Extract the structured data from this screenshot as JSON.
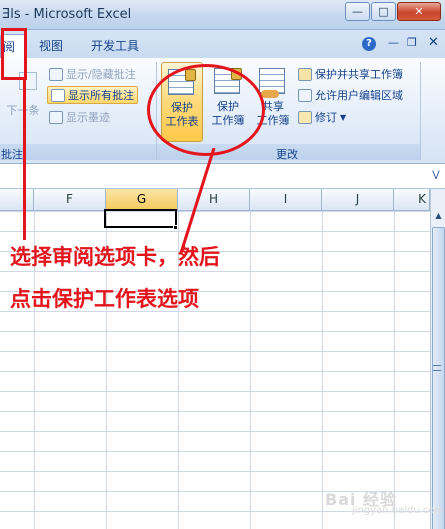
{
  "window": {
    "title": "Ǝls - Microsoft Excel"
  },
  "tabs": [
    {
      "label": "阅"
    },
    {
      "label": "视图"
    },
    {
      "label": "开发工具"
    }
  ],
  "comments_group": {
    "label": "批注",
    "next_label": "下一条",
    "show_hide_label": "显示/隐藏批注",
    "show_all_label": "显示所有批注",
    "show_ink_label": "显示墨迹"
  },
  "changes_group": {
    "label": "更改",
    "protect_sheet_label": "保护\n工作表",
    "protect_workbook_label": "保护\n工作簿",
    "share_workbook_label": "共享\n工作簿",
    "protect_share_label": "保护并共享工作簿",
    "allow_edit_label": "允许用户编辑区域",
    "track_changes_label": "修订"
  },
  "columns": [
    "F",
    "G",
    "H",
    "I",
    "J",
    "K"
  ],
  "selected_column": "G",
  "annotation": {
    "line1": "选择审阅选项卡，然后",
    "line2": "点击保护工作表选项"
  },
  "watermark": {
    "text": "Bai 经验",
    "sub": "jingyan.baidu.com"
  },
  "colors": {
    "annotation_red": "#e3141b",
    "ribbon_blue": "#15428b",
    "selection_gold": "#f5c95e"
  }
}
